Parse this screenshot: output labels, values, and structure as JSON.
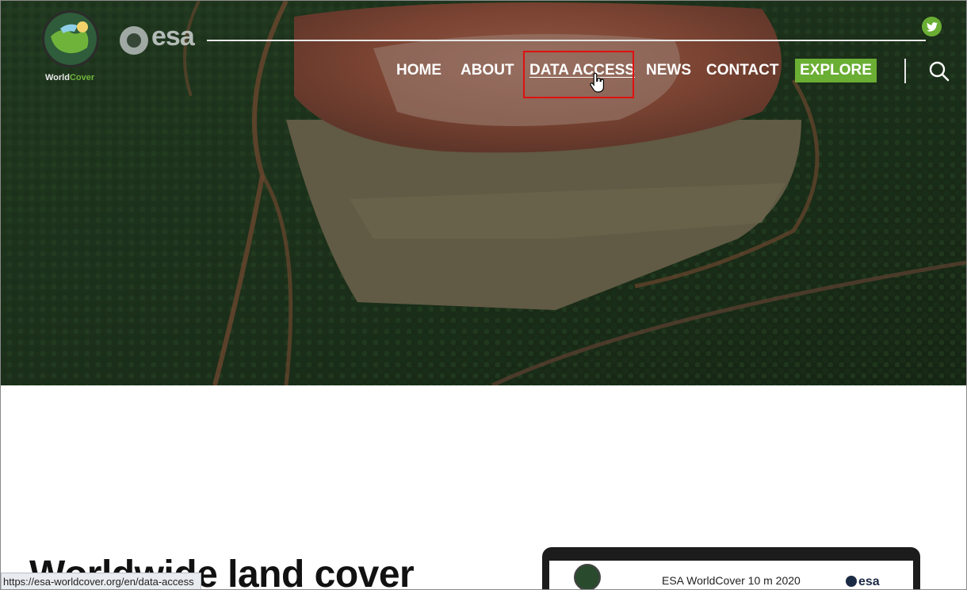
{
  "header": {
    "logo_worldcover": {
      "part1": "World",
      "part2": "Cover"
    },
    "logo_esa": "esa",
    "nav": {
      "home": "HOME",
      "about": "ABOUT",
      "data_access": "DATA ACCESS",
      "news": "NEWS",
      "contact": "CONTACT"
    },
    "explore_label": "EXPLORE",
    "accent_color": "#6aae34"
  },
  "main": {
    "headline": "Worldwide land cover",
    "laptop_screen": {
      "caption": "ESA WorldCover 10 m 2020",
      "logo": "esa"
    }
  },
  "status_bar": {
    "url": "https://esa-worldcover.org/en/data-access"
  },
  "icons": [
    "twitter-icon",
    "search-icon",
    "hand-cursor-icon"
  ]
}
